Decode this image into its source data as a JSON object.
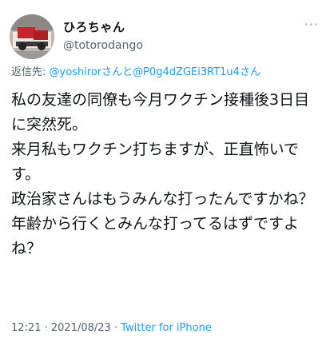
{
  "user": {
    "display_name": "ひろちゃん",
    "handle": "@totorodango",
    "avatar_icon": "avatar-photo"
  },
  "menu": {
    "more_label": "···"
  },
  "reply": {
    "prefix": "返信先: ",
    "mention_1": "@yoshiror",
    "joiner": "さんと",
    "mention_2": "@P0g4dZGEi3RT1u4",
    "suffix": "さん"
  },
  "tweet": {
    "text": "私の友達の同僚も今月ワクチン接種後3日目に突然死。\n来月私もワクチン打ちますが、正直怖いです。\n政治家さんはもうみんな打ったんですかね？\n年齢から行くとみんな打ってるはずですよね？"
  },
  "meta": {
    "time": "12:21",
    "separator_1": " · ",
    "date": "2021/08/23",
    "separator_2": " · ",
    "source": "Twitter for iPhone"
  },
  "colors": {
    "link": "#1d9bf0",
    "secondary_text": "#536471",
    "primary_text": "#0f1419"
  }
}
